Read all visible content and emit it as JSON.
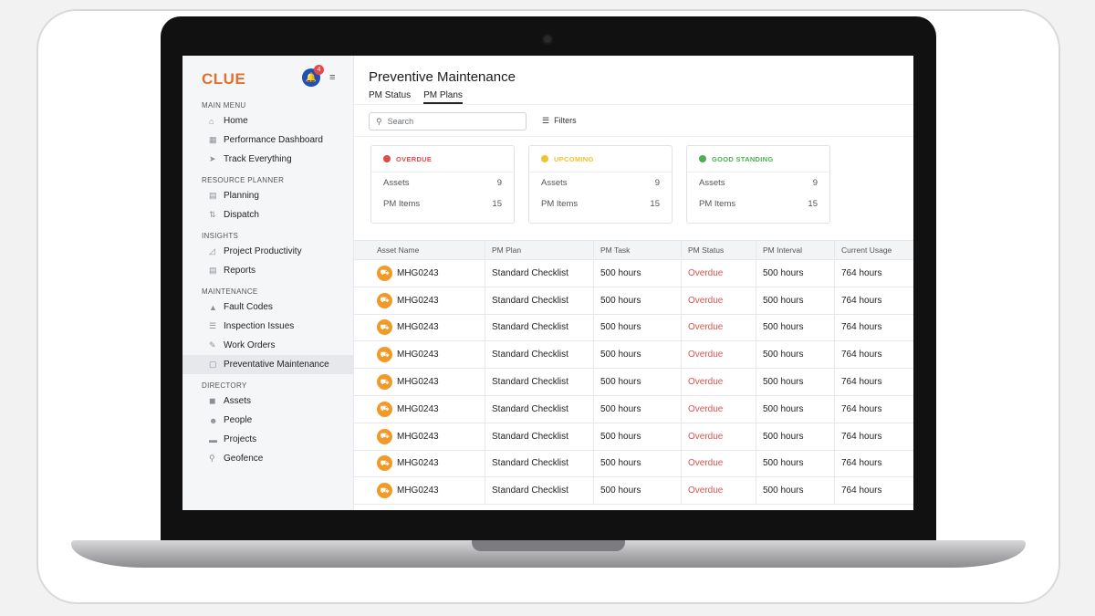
{
  "app": {
    "logo": "CLUE",
    "notification_count": "4",
    "notification_icon": "bell-icon",
    "collapse_icon": "menu-collapse-icon"
  },
  "sidebar": {
    "sections": [
      {
        "title": "MAIN MENU",
        "items": [
          {
            "label": "Home",
            "icon": "⌂"
          },
          {
            "label": "Performance Dashboard",
            "icon": "▦"
          },
          {
            "label": "Track Everything",
            "icon": "➤"
          }
        ]
      },
      {
        "title": "RESOURCE PLANNER",
        "items": [
          {
            "label": "Planning",
            "icon": "▤"
          },
          {
            "label": "Dispatch",
            "icon": "⇅"
          }
        ]
      },
      {
        "title": "INSIGHTS",
        "items": [
          {
            "label": "Project Productivity",
            "icon": "◿"
          },
          {
            "label": "Reports",
            "icon": "▤"
          }
        ]
      },
      {
        "title": "MAINTENANCE",
        "items": [
          {
            "label": "Fault Codes",
            "icon": "▲"
          },
          {
            "label": "Inspection Issues",
            "icon": "☰"
          },
          {
            "label": "Work Orders",
            "icon": "✎"
          },
          {
            "label": "Preventative Maintenance",
            "icon": "▢"
          }
        ]
      },
      {
        "title": "DIRECTORY",
        "items": [
          {
            "label": "Assets",
            "icon": "◼"
          },
          {
            "label": "People",
            "icon": "☻"
          },
          {
            "label": "Projects",
            "icon": "▬"
          },
          {
            "label": "Geofence",
            "icon": "⚲"
          }
        ]
      }
    ],
    "active_item": "Preventative Maintenance"
  },
  "main": {
    "title": "Preventive Maintenance",
    "tabs": [
      {
        "label": "PM Status"
      },
      {
        "label": "PM Plans"
      }
    ],
    "active_tab": "PM Plans",
    "search": {
      "placeholder": "Search"
    },
    "filters_label": "Filters"
  },
  "stat_cards": [
    {
      "title": "OVERDUE",
      "color": "#e04b4b",
      "rows": [
        {
          "label": "Assets",
          "value": "9"
        },
        {
          "label": "PM Items",
          "value": "15"
        }
      ]
    },
    {
      "title": "UPCOMING",
      "color": "#f2c230",
      "rows": [
        {
          "label": "Assets",
          "value": "9"
        },
        {
          "label": "PM Items",
          "value": "15"
        }
      ]
    },
    {
      "title": "GOOD STANDING",
      "color": "#4cb04f",
      "rows": [
        {
          "label": "Assets",
          "value": "9"
        },
        {
          "label": "PM Items",
          "value": "15"
        }
      ]
    }
  ],
  "table": {
    "columns": [
      "Asset Name",
      "PM Plan",
      "PM Task",
      "PM Status",
      "PM Interval",
      "Current Usage"
    ],
    "rows": [
      [
        "MHG0243",
        "Standard Checklist",
        "500 hours",
        "Overdue",
        "500 hours",
        "764 hours"
      ],
      [
        "MHG0243",
        "Standard Checklist",
        "500 hours",
        "Overdue",
        "500 hours",
        "764 hours"
      ],
      [
        "MHG0243",
        "Standard Checklist",
        "500 hours",
        "Overdue",
        "500 hours",
        "764 hours"
      ],
      [
        "MHG0243",
        "Standard Checklist",
        "500 hours",
        "Overdue",
        "500 hours",
        "764 hours"
      ],
      [
        "MHG0243",
        "Standard Checklist",
        "500 hours",
        "Overdue",
        "500 hours",
        "764 hours"
      ],
      [
        "MHG0243",
        "Standard Checklist",
        "500 hours",
        "Overdue",
        "500 hours",
        "764 hours"
      ],
      [
        "MHG0243",
        "Standard Checklist",
        "500 hours",
        "Overdue",
        "500 hours",
        "764 hours"
      ],
      [
        "MHG0243",
        "Standard Checklist",
        "500 hours",
        "Overdue",
        "500 hours",
        "764 hours"
      ],
      [
        "MHG0243",
        "Standard Checklist",
        "500 hours",
        "Overdue",
        "500 hours",
        "764 hours"
      ]
    ]
  }
}
